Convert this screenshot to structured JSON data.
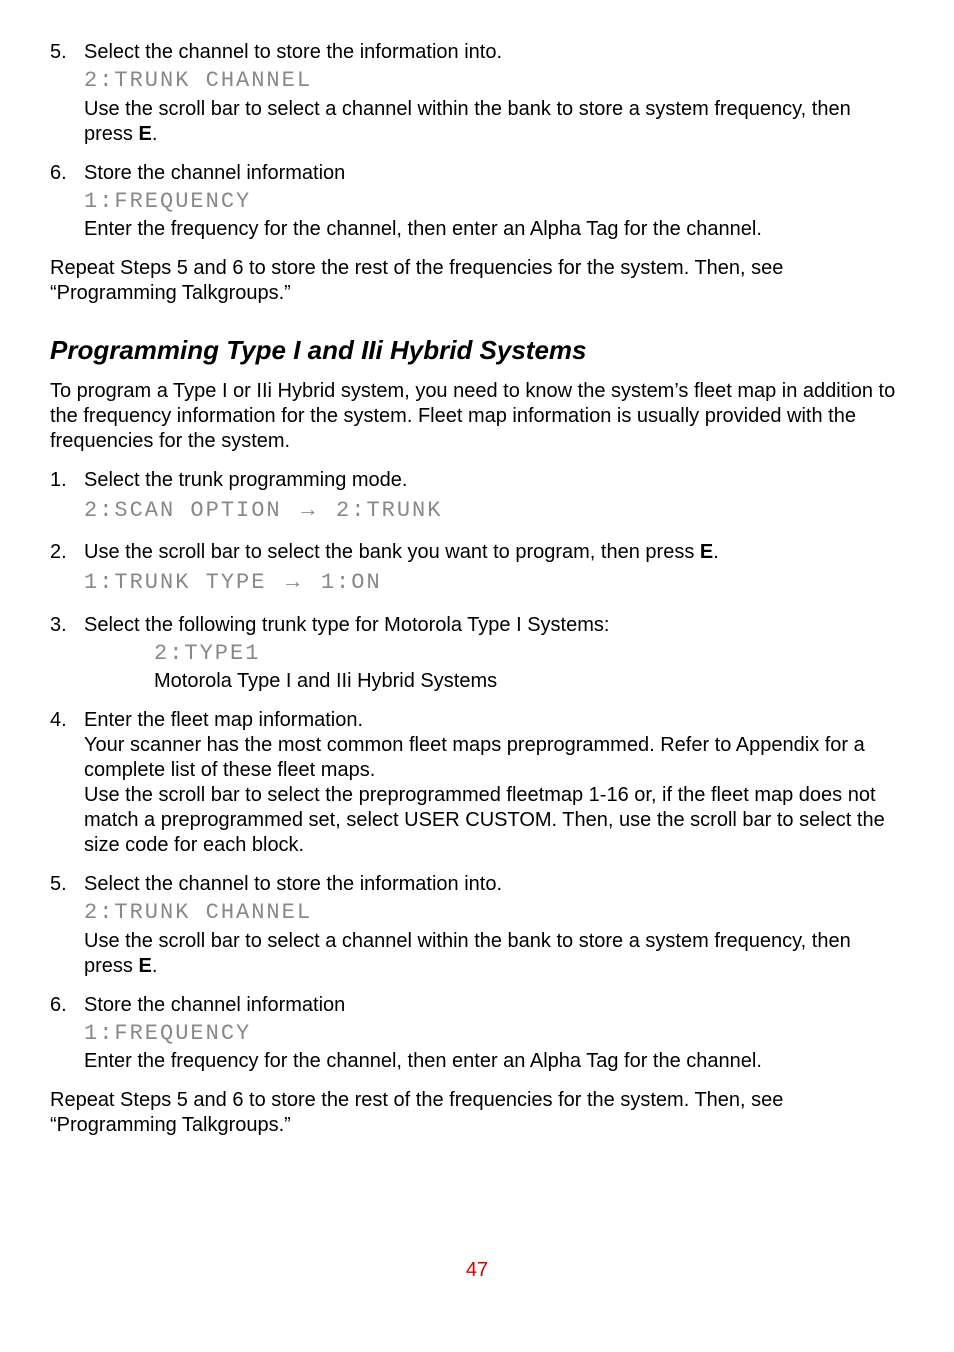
{
  "topList": [
    {
      "num": "5.",
      "lead": "Select the channel to store the information into.",
      "display": "2:TRUNK CHANNEL",
      "body_a": "Use the scroll bar to select a channel within the bank to store a system frequency, then press ",
      "body_b": "E",
      "body_c": "."
    },
    {
      "num": "6.",
      "lead": "Store the channel information",
      "display": "1:FREQUENCY",
      "body_a": "Enter the frequency for the channel, then enter an Alpha Tag for the channel.",
      "body_b": "",
      "body_c": ""
    }
  ],
  "topRepeat": "Repeat Steps 5 and 6 to store the rest of the frequencies for the system. Then, see “Programming Talkgroups.”",
  "heading": "Programming Type I and IIi Hybrid Systems",
  "introPara": "To program a Type I or IIi Hybrid system, you need to know the system’s fleet map in addition to the frequency information for the system. Fleet map information is usually provided with the frequencies for the system.",
  "step1": {
    "num": "1.",
    "lead": "Select the trunk programming mode.",
    "disp_a": "2:SCAN OPTION",
    "arrow": "→",
    "disp_b": "2:TRUNK"
  },
  "step2": {
    "num": "2.",
    "lead_a": "Use the scroll bar to select the bank you want to program, then press ",
    "lead_b": "E",
    "lead_c": ".",
    "disp_a": "1:TRUNK TYPE",
    "arrow": "→",
    "disp_b": "1:ON"
  },
  "step3": {
    "num": "3.",
    "lead": "Select the following trunk type for Motorola Type I Systems:",
    "disp": "2:TYPE1",
    "sub": "Motorola Type I and IIi Hybrid Systems"
  },
  "step4": {
    "num": "4.",
    "lead": "Enter the fleet map information.",
    "p1": "Your scanner has the most common fleet maps preprogrammed. Refer to Appendix for a complete list of these fleet maps.",
    "p2": "Use the scroll bar to select the preprogrammed fleetmap 1-16 or, if the fleet map does not match a preprogrammed set, select USER CUSTOM. Then, use the scroll bar to select the size code for each block."
  },
  "step5": {
    "num": "5.",
    "lead": "Select the channel to store the information into.",
    "display": "2:TRUNK CHANNEL",
    "body_a": "Use the scroll bar to select a channel within the bank to store a system frequency, then press ",
    "body_b": "E",
    "body_c": "."
  },
  "step6": {
    "num": "6.",
    "lead": "Store the channel information",
    "display": "1:FREQUENCY",
    "body": "Enter the frequency for the channel, then enter an Alpha Tag for the channel."
  },
  "bottomRepeat": "Repeat Steps 5 and 6 to store the rest of the frequencies for the system. Then, see “Programming Talkgroups.”",
  "pageNum": "47"
}
